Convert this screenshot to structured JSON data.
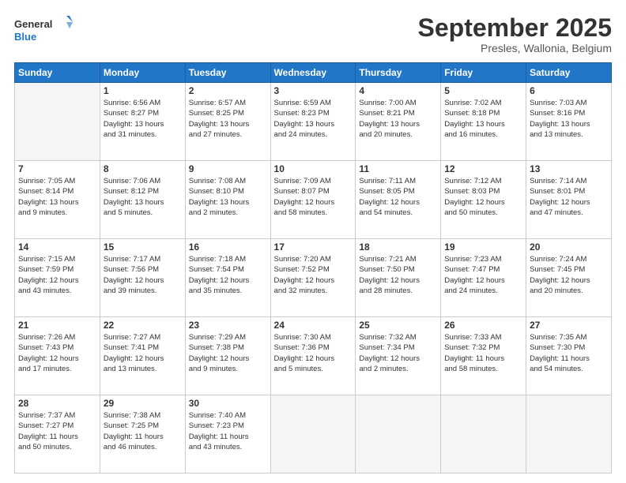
{
  "logo": {
    "line1": "General",
    "line2": "Blue"
  },
  "title": "September 2025",
  "location": "Presles, Wallonia, Belgium",
  "days_header": [
    "Sunday",
    "Monday",
    "Tuesday",
    "Wednesday",
    "Thursday",
    "Friday",
    "Saturday"
  ],
  "weeks": [
    [
      {
        "day": "",
        "info": ""
      },
      {
        "day": "1",
        "info": "Sunrise: 6:56 AM\nSunset: 8:27 PM\nDaylight: 13 hours\nand 31 minutes."
      },
      {
        "day": "2",
        "info": "Sunrise: 6:57 AM\nSunset: 8:25 PM\nDaylight: 13 hours\nand 27 minutes."
      },
      {
        "day": "3",
        "info": "Sunrise: 6:59 AM\nSunset: 8:23 PM\nDaylight: 13 hours\nand 24 minutes."
      },
      {
        "day": "4",
        "info": "Sunrise: 7:00 AM\nSunset: 8:21 PM\nDaylight: 13 hours\nand 20 minutes."
      },
      {
        "day": "5",
        "info": "Sunrise: 7:02 AM\nSunset: 8:18 PM\nDaylight: 13 hours\nand 16 minutes."
      },
      {
        "day": "6",
        "info": "Sunrise: 7:03 AM\nSunset: 8:16 PM\nDaylight: 13 hours\nand 13 minutes."
      }
    ],
    [
      {
        "day": "7",
        "info": "Sunrise: 7:05 AM\nSunset: 8:14 PM\nDaylight: 13 hours\nand 9 minutes."
      },
      {
        "day": "8",
        "info": "Sunrise: 7:06 AM\nSunset: 8:12 PM\nDaylight: 13 hours\nand 5 minutes."
      },
      {
        "day": "9",
        "info": "Sunrise: 7:08 AM\nSunset: 8:10 PM\nDaylight: 13 hours\nand 2 minutes."
      },
      {
        "day": "10",
        "info": "Sunrise: 7:09 AM\nSunset: 8:07 PM\nDaylight: 12 hours\nand 58 minutes."
      },
      {
        "day": "11",
        "info": "Sunrise: 7:11 AM\nSunset: 8:05 PM\nDaylight: 12 hours\nand 54 minutes."
      },
      {
        "day": "12",
        "info": "Sunrise: 7:12 AM\nSunset: 8:03 PM\nDaylight: 12 hours\nand 50 minutes."
      },
      {
        "day": "13",
        "info": "Sunrise: 7:14 AM\nSunset: 8:01 PM\nDaylight: 12 hours\nand 47 minutes."
      }
    ],
    [
      {
        "day": "14",
        "info": "Sunrise: 7:15 AM\nSunset: 7:59 PM\nDaylight: 12 hours\nand 43 minutes."
      },
      {
        "day": "15",
        "info": "Sunrise: 7:17 AM\nSunset: 7:56 PM\nDaylight: 12 hours\nand 39 minutes."
      },
      {
        "day": "16",
        "info": "Sunrise: 7:18 AM\nSunset: 7:54 PM\nDaylight: 12 hours\nand 35 minutes."
      },
      {
        "day": "17",
        "info": "Sunrise: 7:20 AM\nSunset: 7:52 PM\nDaylight: 12 hours\nand 32 minutes."
      },
      {
        "day": "18",
        "info": "Sunrise: 7:21 AM\nSunset: 7:50 PM\nDaylight: 12 hours\nand 28 minutes."
      },
      {
        "day": "19",
        "info": "Sunrise: 7:23 AM\nSunset: 7:47 PM\nDaylight: 12 hours\nand 24 minutes."
      },
      {
        "day": "20",
        "info": "Sunrise: 7:24 AM\nSunset: 7:45 PM\nDaylight: 12 hours\nand 20 minutes."
      }
    ],
    [
      {
        "day": "21",
        "info": "Sunrise: 7:26 AM\nSunset: 7:43 PM\nDaylight: 12 hours\nand 17 minutes."
      },
      {
        "day": "22",
        "info": "Sunrise: 7:27 AM\nSunset: 7:41 PM\nDaylight: 12 hours\nand 13 minutes."
      },
      {
        "day": "23",
        "info": "Sunrise: 7:29 AM\nSunset: 7:38 PM\nDaylight: 12 hours\nand 9 minutes."
      },
      {
        "day": "24",
        "info": "Sunrise: 7:30 AM\nSunset: 7:36 PM\nDaylight: 12 hours\nand 5 minutes."
      },
      {
        "day": "25",
        "info": "Sunrise: 7:32 AM\nSunset: 7:34 PM\nDaylight: 12 hours\nand 2 minutes."
      },
      {
        "day": "26",
        "info": "Sunrise: 7:33 AM\nSunset: 7:32 PM\nDaylight: 11 hours\nand 58 minutes."
      },
      {
        "day": "27",
        "info": "Sunrise: 7:35 AM\nSunset: 7:30 PM\nDaylight: 11 hours\nand 54 minutes."
      }
    ],
    [
      {
        "day": "28",
        "info": "Sunrise: 7:37 AM\nSunset: 7:27 PM\nDaylight: 11 hours\nand 50 minutes."
      },
      {
        "day": "29",
        "info": "Sunrise: 7:38 AM\nSunset: 7:25 PM\nDaylight: 11 hours\nand 46 minutes."
      },
      {
        "day": "30",
        "info": "Sunrise: 7:40 AM\nSunset: 7:23 PM\nDaylight: 11 hours\nand 43 minutes."
      },
      {
        "day": "",
        "info": ""
      },
      {
        "day": "",
        "info": ""
      },
      {
        "day": "",
        "info": ""
      },
      {
        "day": "",
        "info": ""
      }
    ]
  ]
}
